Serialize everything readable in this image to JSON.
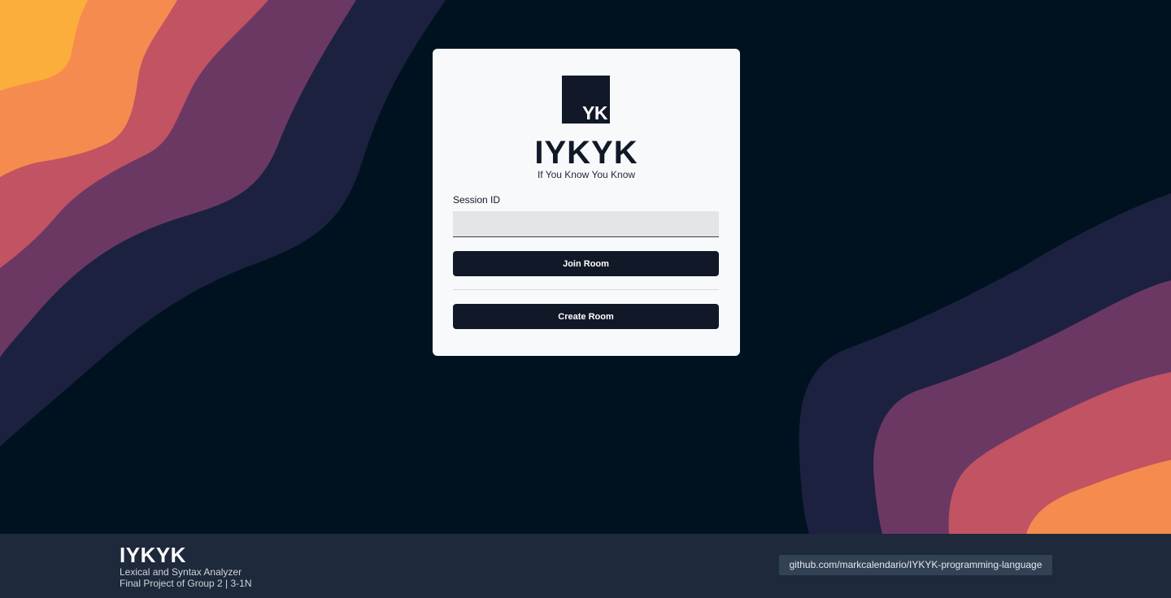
{
  "colors": {
    "background": "#001220",
    "wave_navy": "#1d2140",
    "wave_purple": "#6b3864",
    "wave_rose": "#c25363",
    "wave_orange": "#f58b4e",
    "wave_yellow": "#fbae3c",
    "card_bg": "#f7f9fb",
    "button_bg": "#111827",
    "footer_bg": "#1e293b"
  },
  "card": {
    "logo_text": "YK",
    "title": "IYKYK",
    "subtitle": "If You Know You Know",
    "session_label": "Session ID",
    "session_value": "",
    "join_label": "Join Room",
    "create_label": "Create Room"
  },
  "footer": {
    "title": "IYKYK",
    "line1": "Lexical and Syntax Analyzer",
    "line2": "Final Project of Group 2 | 3-1N",
    "repo_link": "github.com/markcalendario/IYKYK-programming-language"
  }
}
